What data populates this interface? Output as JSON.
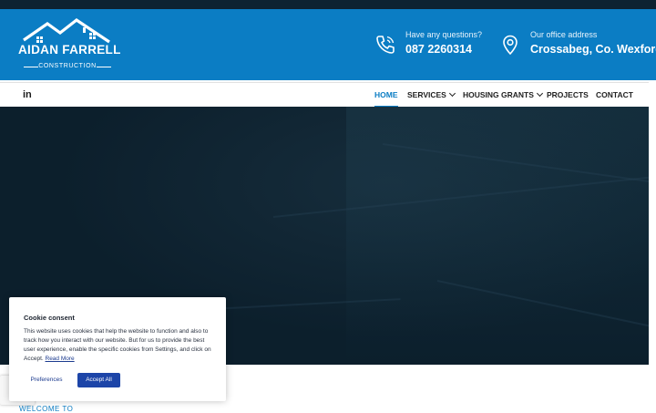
{
  "brand": {
    "name": "AIDAN FARRELL",
    "tagline": "CONSTRUCTION"
  },
  "contact": {
    "phone": {
      "label": "Have any questions?",
      "value": "087 2260314",
      "icon": "phone-icon"
    },
    "address": {
      "label": "Our office address",
      "value": "Crossabeg, Co. Wexford",
      "icon": "location-pin-icon"
    }
  },
  "social": {
    "linkedin": "in"
  },
  "nav": {
    "home": "HOME",
    "services": "SERVICES",
    "housing_grants": "HOUSING GRANTS",
    "projects": "PROJECTS",
    "contact": "CONTACT"
  },
  "cookie": {
    "title": "Cookie consent",
    "body": "This website uses cookies that help the website to function and also to track how you interact with our website. But for us to provide the best user experience, enable the specific cookies from Settings, and click on Accept.",
    "read_more": "Read More",
    "preferences": "Preferences",
    "accept": "Accept All"
  },
  "section": {
    "welcome": "WELCOME TO"
  },
  "colors": {
    "brand_blue": "#0b7dc4",
    "hero_dark": "#0c1f2c",
    "accept_blue": "#1d45a8",
    "link_blue": "#1c3b8f"
  }
}
